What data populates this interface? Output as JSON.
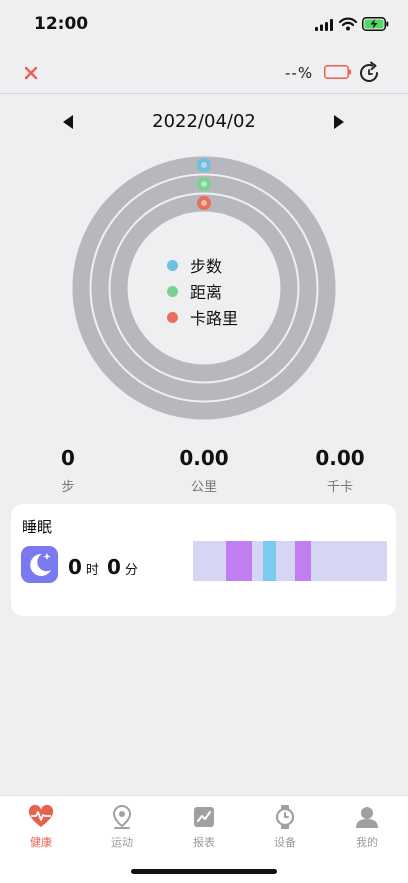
{
  "status_bar": {
    "time": "12:00"
  },
  "header": {
    "battery_text": "--%"
  },
  "date": {
    "label": "2022/04/02"
  },
  "legend": [
    {
      "label": "步数",
      "color": "#6fbfe0"
    },
    {
      "label": "距离",
      "color": "#79d28f"
    },
    {
      "label": "卡路里",
      "color": "#e8705a"
    }
  ],
  "stats": [
    {
      "value": "0",
      "unit": "步"
    },
    {
      "value": "0.00",
      "unit": "公里"
    },
    {
      "value": "0.00",
      "unit": "千卡"
    }
  ],
  "sleep": {
    "title": "睡眠",
    "hours": "0",
    "hours_unit": "时",
    "minutes": "0",
    "minutes_unit": "分"
  },
  "tabs": [
    {
      "label": "健康",
      "icon": "heart-pulse-icon",
      "active": true
    },
    {
      "label": "运动",
      "icon": "location-pin-icon",
      "active": false
    },
    {
      "label": "报表",
      "icon": "chart-report-icon",
      "active": false
    },
    {
      "label": "设备",
      "icon": "watch-icon",
      "active": false
    },
    {
      "label": "我的",
      "icon": "profile-icon",
      "active": false
    }
  ],
  "colors": {
    "accent": "#e8614f",
    "ring_track": "#b7b8bd",
    "sleep_light": "#d4d6f4",
    "sleep_deep": "#c07ef0",
    "sleep_awake": "#7ccaf0"
  }
}
